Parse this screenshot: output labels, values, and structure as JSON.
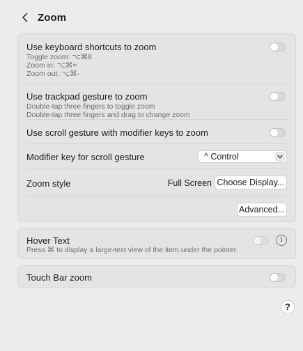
{
  "header": {
    "title": "Zoom"
  },
  "keyboard": {
    "label": "Use keyboard shortcuts to zoom",
    "lines": [
      "Toggle zoom: ⌥⌘8",
      "Zoom in: ⌥⌘=",
      "Zoom out: ⌥⌘-"
    ],
    "enabled": false
  },
  "trackpad": {
    "label": "Use trackpad gesture to zoom",
    "lines": [
      "Double-tap three fingers to toggle zoom",
      "Double-tap three fingers and drag to change zoom"
    ],
    "enabled": false
  },
  "scroll": {
    "label": "Use scroll gesture with modifier keys to zoom",
    "enabled": false
  },
  "modifier": {
    "label": "Modifier key for scroll gesture",
    "value": "^ Control"
  },
  "zoom_style": {
    "label": "Zoom style",
    "value": "Full Screen",
    "choose_display": "Choose Display..."
  },
  "advanced": {
    "label": "Advanced..."
  },
  "hover_text": {
    "label": "Hover Text",
    "description": "Press ⌘ to display a large-text view of the item under the pointer.",
    "enabled": false,
    "info_glyph": "i"
  },
  "touch_bar": {
    "label": "Touch Bar zoom",
    "enabled": false
  },
  "help": {
    "label": "?"
  }
}
